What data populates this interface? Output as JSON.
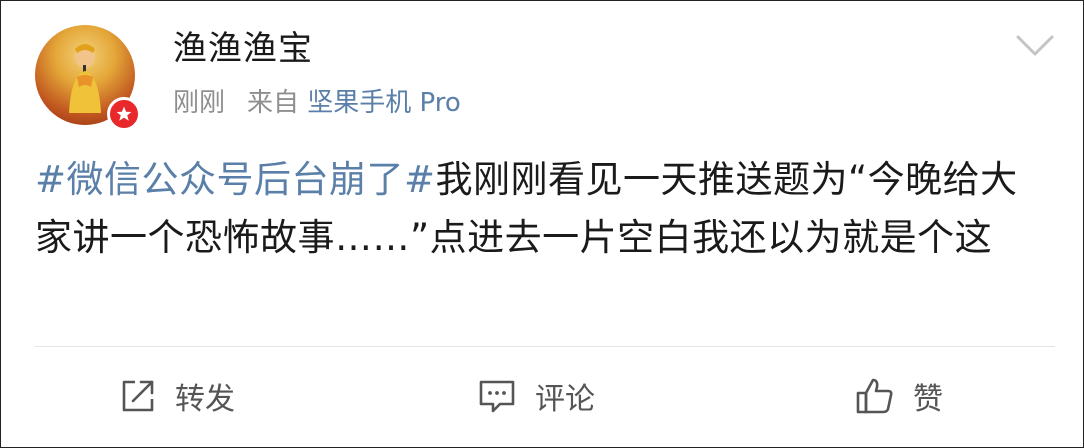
{
  "post": {
    "author": {
      "username": "渔渔渔宝",
      "avatar_icon": "avatar-photo",
      "badge_icon": "verified-star-icon",
      "badge_color": "#e8282b"
    },
    "meta": {
      "time": "刚刚",
      "from_label": "来自",
      "source": "坚果手机 Pro"
    },
    "menu_icon": "chevron-down-icon",
    "content": {
      "topic": "#微信公众号后台崩了#",
      "text": "我刚刚看见一天推送题为“今晚给大家讲一个恐怖故事……”点进去一片空白我还以为就是个这"
    },
    "actions": {
      "repost_label": "转发",
      "comment_label": "评论",
      "like_label": "赞"
    }
  },
  "colors": {
    "link": "#5a7fa8",
    "meta": "#8f8f8f",
    "text": "#1a1a1a"
  }
}
